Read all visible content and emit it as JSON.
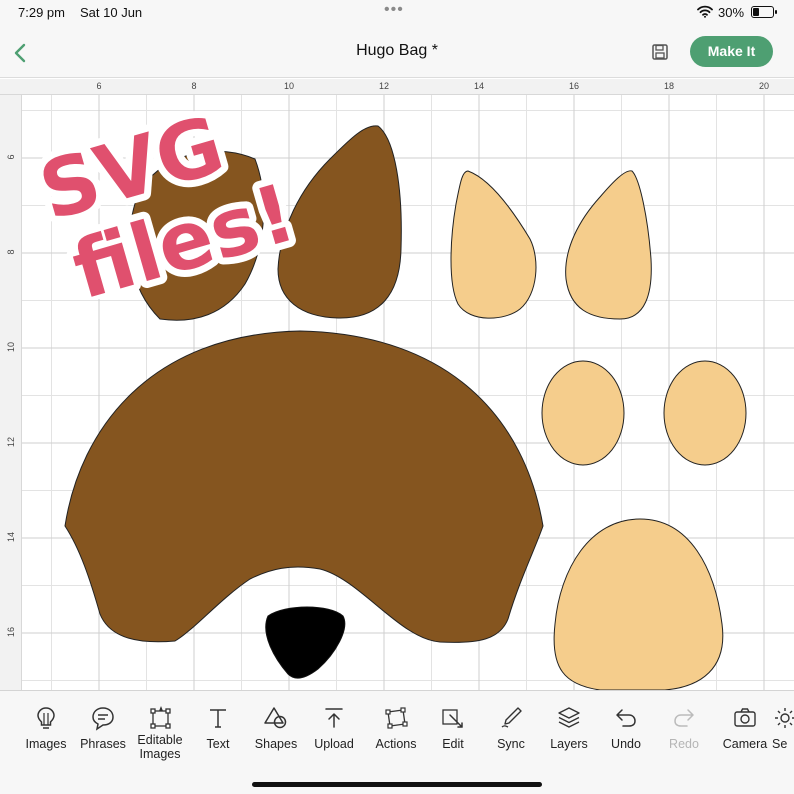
{
  "status_bar": {
    "time": "7:29 pm",
    "date": "Sat 10 Jun",
    "battery": "30%",
    "battery_level": 0.3
  },
  "header": {
    "title": "Hugo Bag *",
    "make_it_label": "Make It",
    "icons": {
      "back": "chevron-left-icon",
      "save": "floppy-disk-icon"
    },
    "accent_color": "#4e9f72"
  },
  "canvas": {
    "ruler_x_labels": [
      "6",
      "8",
      "10",
      "12",
      "14",
      "16",
      "18",
      "20"
    ],
    "ruler_y_labels": [
      "6",
      "8",
      "10",
      "12",
      "14",
      "16"
    ],
    "overlay_text": [
      "SVG",
      "files!"
    ],
    "overlay_color": "#e0506e",
    "fill_brown": "#85551f",
    "fill_tan": "#f5cd8c",
    "fill_black": "#000000"
  },
  "toolbar": {
    "tools": [
      {
        "label": "Images",
        "icon": "lightbulb-icon"
      },
      {
        "label": "Phrases",
        "icon": "speech-bubble-icon"
      },
      {
        "label": "Editable\nImages",
        "icon": "editable-images-icon"
      },
      {
        "label": "Text",
        "icon": "text-icon"
      },
      {
        "label": "Shapes",
        "icon": "shapes-icon"
      },
      {
        "label": "Upload",
        "icon": "upload-icon"
      },
      {
        "label": "Actions",
        "icon": "actions-icon"
      },
      {
        "label": "Edit",
        "icon": "edit-icon"
      },
      {
        "label": "Sync",
        "icon": "sync-icon"
      },
      {
        "label": "Layers",
        "icon": "layers-icon"
      },
      {
        "label": "Undo",
        "icon": "undo-icon"
      },
      {
        "label": "Redo",
        "icon": "redo-icon",
        "disabled": true
      },
      {
        "label": "Camera",
        "icon": "camera-icon"
      },
      {
        "label": "Se",
        "icon": "settings-icon"
      }
    ]
  }
}
